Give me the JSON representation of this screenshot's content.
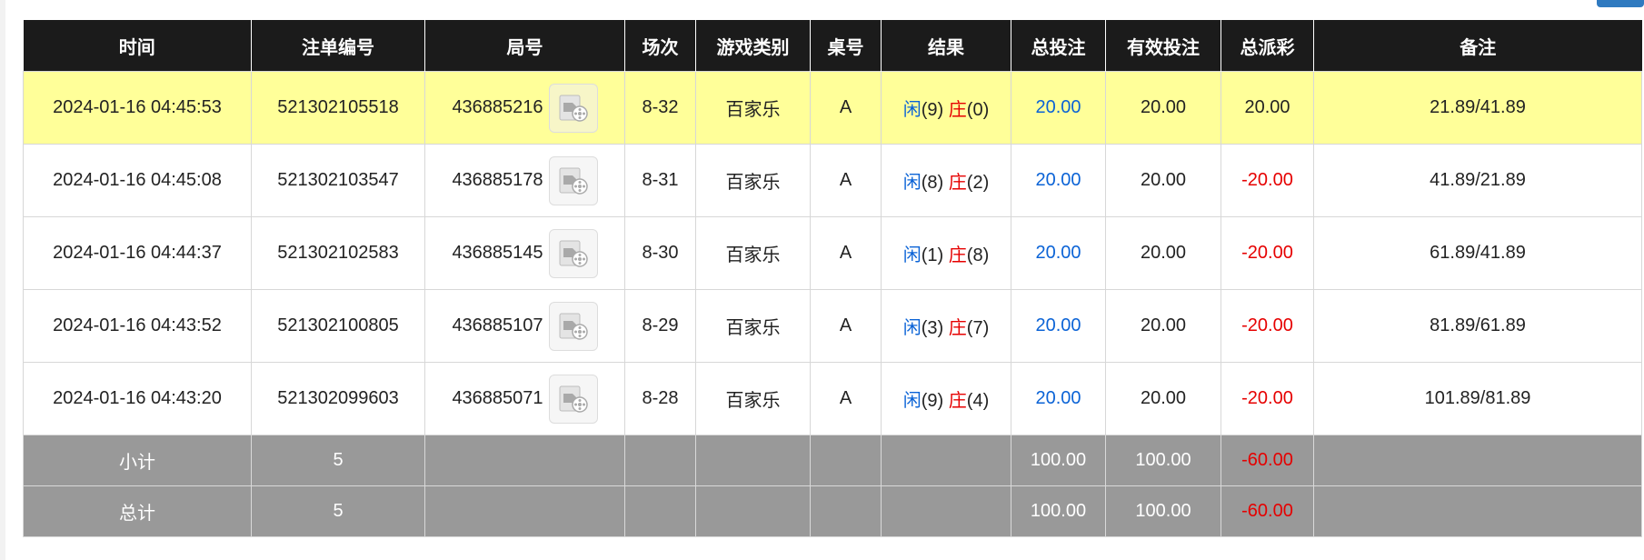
{
  "table": {
    "headers": [
      "时间",
      "注单编号",
      "局号",
      "场次",
      "游戏类别",
      "桌号",
      "结果",
      "总投注",
      "有效投注",
      "总派彩",
      "备注"
    ],
    "rows": [
      {
        "time": "2024-01-16 04:45:53",
        "bet_no": "521302105518",
        "round_no": "436885216",
        "session": "8-32",
        "game": "百家乐",
        "table_no": "A",
        "result_player_label": "闲",
        "result_player_value": "(9)",
        "result_banker_label": "庄",
        "result_banker_value": "(0)",
        "total_bet": "20.00",
        "valid_bet": "20.00",
        "payout": "20.00",
        "remark": "21.89/41.89"
      },
      {
        "time": "2024-01-16 04:45:08",
        "bet_no": "521302103547",
        "round_no": "436885178",
        "session": "8-31",
        "game": "百家乐",
        "table_no": "A",
        "result_player_label": "闲",
        "result_player_value": "(8)",
        "result_banker_label": "庄",
        "result_banker_value": "(2)",
        "total_bet": "20.00",
        "valid_bet": "20.00",
        "payout": "-20.00",
        "remark": "41.89/21.89"
      },
      {
        "time": "2024-01-16 04:44:37",
        "bet_no": "521302102583",
        "round_no": "436885145",
        "session": "8-30",
        "game": "百家乐",
        "table_no": "A",
        "result_player_label": "闲",
        "result_player_value": "(1)",
        "result_banker_label": "庄",
        "result_banker_value": "(8)",
        "total_bet": "20.00",
        "valid_bet": "20.00",
        "payout": "-20.00",
        "remark": "61.89/41.89"
      },
      {
        "time": "2024-01-16 04:43:52",
        "bet_no": "521302100805",
        "round_no": "436885107",
        "session": "8-29",
        "game": "百家乐",
        "table_no": "A",
        "result_player_label": "闲",
        "result_player_value": "(3)",
        "result_banker_label": "庄",
        "result_banker_value": "(7)",
        "total_bet": "20.00",
        "valid_bet": "20.00",
        "payout": "-20.00",
        "remark": "81.89/61.89"
      },
      {
        "time": "2024-01-16 04:43:20",
        "bet_no": "521302099603",
        "round_no": "436885071",
        "session": "8-28",
        "game": "百家乐",
        "table_no": "A",
        "result_player_label": "闲",
        "result_player_value": "(9)",
        "result_banker_label": "庄",
        "result_banker_value": "(4)",
        "total_bet": "20.00",
        "valid_bet": "20.00",
        "payout": "-20.00",
        "remark": "101.89/81.89"
      }
    ],
    "subtotal": {
      "label": "小计",
      "count": "5",
      "total_bet": "100.00",
      "valid_bet": "100.00",
      "payout": "-60.00"
    },
    "grand_total": {
      "label": "总计",
      "count": "5",
      "total_bet": "100.00",
      "valid_bet": "100.00",
      "payout": "-60.00"
    }
  },
  "icons": {
    "replay": "video-replay-icon"
  },
  "colors": {
    "header_bg": "#1b1b1b",
    "highlight_row": "#ffff99",
    "summary_bg": "#999999",
    "blue": "#0b63d6",
    "red": "#e60000"
  }
}
